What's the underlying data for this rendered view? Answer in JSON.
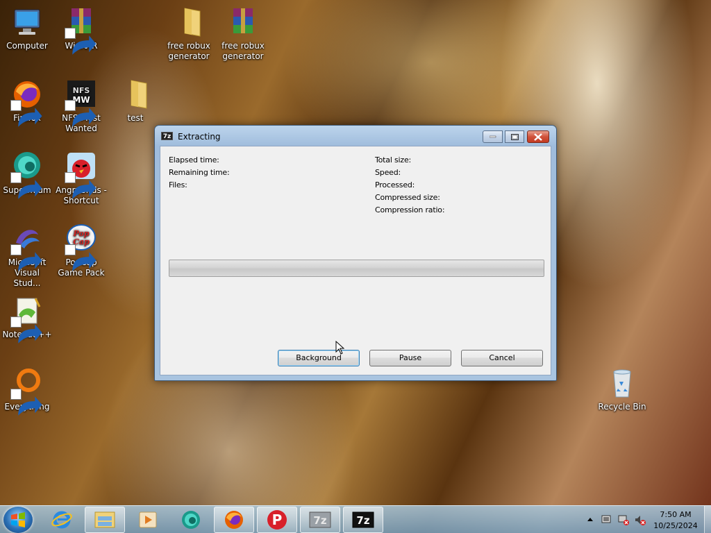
{
  "desktop": {
    "icons": [
      {
        "label": "Computer"
      },
      {
        "label": "WinRAR"
      },
      {
        "label": "free robux generator"
      },
      {
        "label": "free robux generator"
      },
      {
        "label": "Firefox"
      },
      {
        "label": "NFS Most Wanted"
      },
      {
        "label": "test"
      },
      {
        "label": "Supermium"
      },
      {
        "label": "AngryBirds - Shortcut"
      },
      {
        "label": "Microsoft Visual Stud..."
      },
      {
        "label": "PopCap Game Pack"
      },
      {
        "label": "Notepad++"
      },
      {
        "label": "Everything"
      },
      {
        "label": "Recycle Bin"
      }
    ]
  },
  "dialog": {
    "title": "Extracting",
    "app_icon_text": "7z",
    "left_labels": [
      "Elapsed time:",
      "Remaining time:",
      "Files:"
    ],
    "right_labels": [
      "Total size:",
      "Speed:",
      "Processed:",
      "Compressed size:",
      "Compression ratio:"
    ],
    "progress": 0,
    "buttons": {
      "background": "Background",
      "pause": "Pause",
      "cancel": "Cancel"
    }
  },
  "taskbar": {
    "items": [
      "Internet Explorer",
      "Windows Explorer",
      "Media Player",
      "Supermium",
      "Firefox",
      "Psiphon",
      "7-Zip",
      "7-Zip"
    ],
    "tray": {
      "time": "7:50 AM",
      "date": "10/25/2024"
    }
  }
}
